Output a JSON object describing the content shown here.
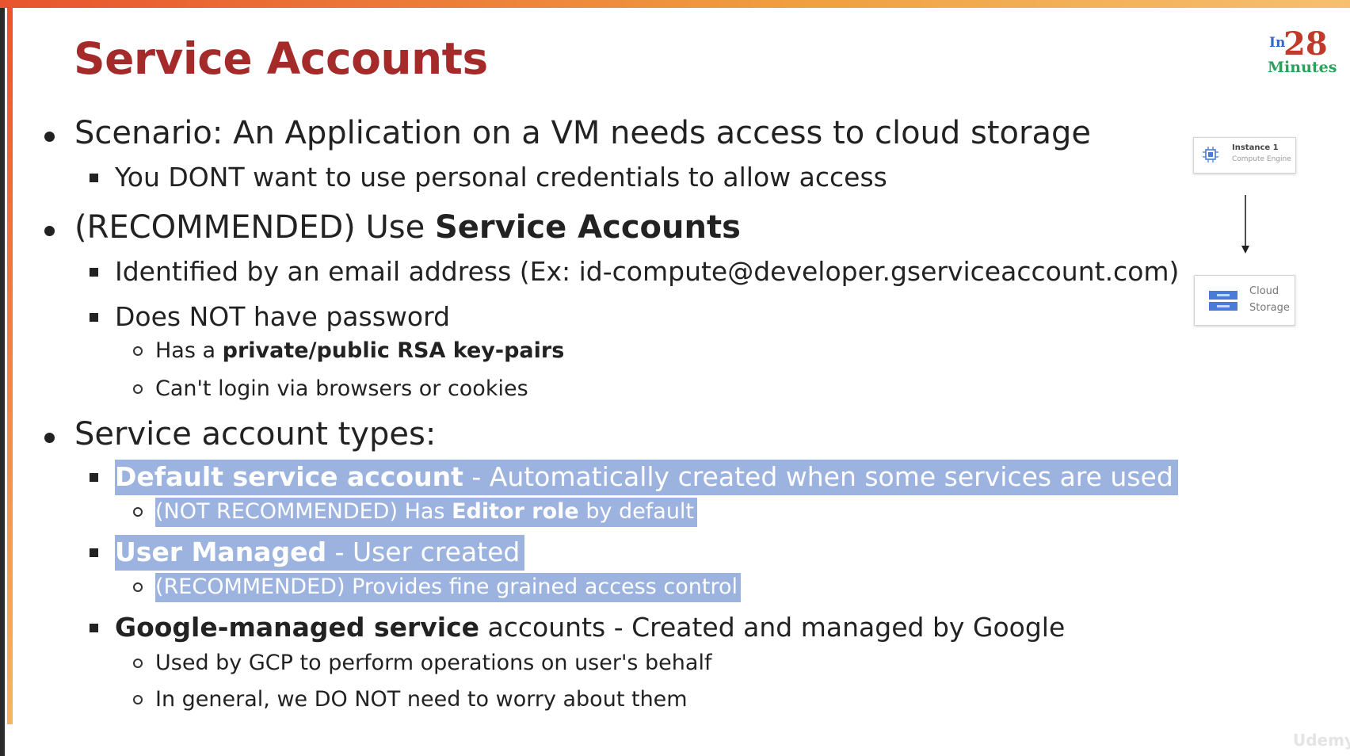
{
  "title": "Service Accounts",
  "logo": {
    "in": "In",
    "number": "28",
    "minutes": "Minutes"
  },
  "bullets": {
    "scenario": "Scenario: An Application on a VM needs access to cloud storage",
    "no_personal": "You DONT want to use personal credentials to allow access",
    "recommended_prefix": "(RECOMMENDED) Use ",
    "recommended_bold": "Service Accounts",
    "identified": "Identified by an email address (Ex: id-compute@developer.gserviceaccount.com)",
    "no_password": "Does NOT have password",
    "keypairs_prefix": "Has a ",
    "keypairs_bold": "private/public RSA key-pairs",
    "cant_login": "Can't login via browsers or cookies",
    "types": "Service account types:",
    "default_bold": "Default service account",
    "default_rest": " - Automatically created when some services are used",
    "default_sub_prefix": "(NOT RECOMMENDED) Has ",
    "default_sub_bold": "Editor role",
    "default_sub_suffix": " by default",
    "user_bold": "User Managed",
    "user_rest": " - User created",
    "user_sub": "(RECOMMENDED) Provides fine grained access control",
    "google_bold": "Google-managed service",
    "google_rest": " accounts - Created and managed by Google",
    "google_sub1": "Used by GCP to perform operations on user's behalf",
    "google_sub2": "In general, we DO NOT need to worry about them"
  },
  "diagram": {
    "instance_title": "Instance 1",
    "instance_sub": "Compute Engine",
    "storage_line1": "Cloud",
    "storage_line2": "Storage"
  },
  "watermark": "Udemy",
  "colors": {
    "title": "#a52a2a",
    "highlight": "#9cb3e0",
    "logo_number": "#c0392b",
    "logo_minutes": "#27a35a"
  }
}
